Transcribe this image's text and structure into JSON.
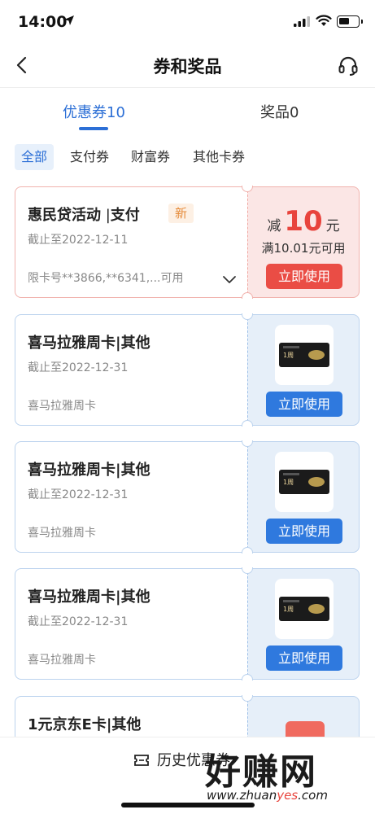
{
  "status_bar": {
    "time": "14:00"
  },
  "nav": {
    "title": "券和奖品"
  },
  "main_tabs": [
    {
      "label": "优惠券10",
      "active": true
    },
    {
      "label": "奖品0",
      "active": false
    }
  ],
  "filters": [
    {
      "label": "全部",
      "active": true
    },
    {
      "label": "支付券",
      "active": false
    },
    {
      "label": "财富券",
      "active": false
    },
    {
      "label": "其他卡券",
      "active": false
    }
  ],
  "coupons": [
    {
      "title": "惠民贷活动",
      "category": "支付",
      "badge": "新",
      "date": "截止至2022-12-11",
      "note": "限卡号**3866,**6341,...可用",
      "discount_prefix": "减",
      "discount_amount": "10",
      "discount_unit": "元",
      "condition": "满10.01元可用",
      "button": "立即使用",
      "theme": "#ea4d45"
    },
    {
      "title": "喜马拉雅周卡",
      "category": "其他",
      "date": "截止至2022-12-31",
      "note": "喜马拉雅周卡",
      "thumb_text": "1周",
      "button": "立即使用",
      "theme": "#2f79de"
    },
    {
      "title": "喜马拉雅周卡",
      "category": "其他",
      "date": "截止至2022-12-31",
      "note": "喜马拉雅周卡",
      "thumb_text": "1周",
      "button": "立即使用",
      "theme": "#2f79de"
    },
    {
      "title": "喜马拉雅周卡",
      "category": "其他",
      "date": "截止至2022-12-31",
      "note": "喜马拉雅周卡",
      "thumb_text": "1周",
      "button": "立即使用",
      "theme": "#2f79de"
    },
    {
      "title": "1元京东E卡",
      "category": "其他"
    }
  ],
  "bottom": {
    "history_label": "历史优惠券"
  },
  "watermark": {
    "main": "好赚网",
    "url_prefix": "www.zhuan",
    "url_highlight": "yes",
    "url_suffix": ".com"
  },
  "colors": {
    "accent": "#2c6fd6",
    "red": "#ea4d45",
    "blue_button": "#2f79de"
  }
}
